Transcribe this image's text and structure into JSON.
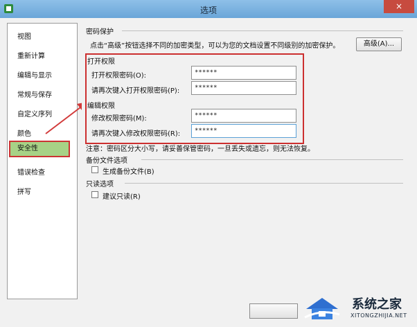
{
  "window": {
    "title": "选项",
    "close_label": "×"
  },
  "sidebar": {
    "items": [
      {
        "label": "视图"
      },
      {
        "label": "重新计算"
      },
      {
        "label": "编辑与显示"
      },
      {
        "label": "常规与保存"
      },
      {
        "label": "自定义序列"
      },
      {
        "label": "颜色"
      },
      {
        "label": "安全性"
      },
      {
        "label": "错误检查"
      },
      {
        "label": "拼写"
      }
    ],
    "selected": "安全性"
  },
  "password": {
    "section_title": "密码保护",
    "description": "点击“高级”按钮选择不同的加密类型，可以为您的文档设置不同级别的加密保护。",
    "advanced_label": "高级(A)...",
    "open_group": "打开权限",
    "open_password_label": "打开权限密码(O):",
    "open_password_value": "******",
    "open_confirm_label": "请再次键入打开权限密码(P):",
    "open_confirm_value": "******",
    "edit_group": "编辑权限",
    "edit_password_label": "修改权限密码(M):",
    "edit_password_value": "******",
    "edit_confirm_label": "请再次键入修改权限密码(R):",
    "edit_confirm_value": "******",
    "note": "注意：密码区分大小写，请妥善保管密码，一旦丢失或遗忘，则无法恢复。"
  },
  "backup": {
    "section_title": "备份文件选项",
    "checkbox_label": "生成备份文件(B)"
  },
  "readonly": {
    "section_title": "只读选项",
    "checkbox_label": "建议只读(R)"
  },
  "watermark": {
    "title": "系统之家",
    "url": "XITONGZHIJIA.NET"
  }
}
